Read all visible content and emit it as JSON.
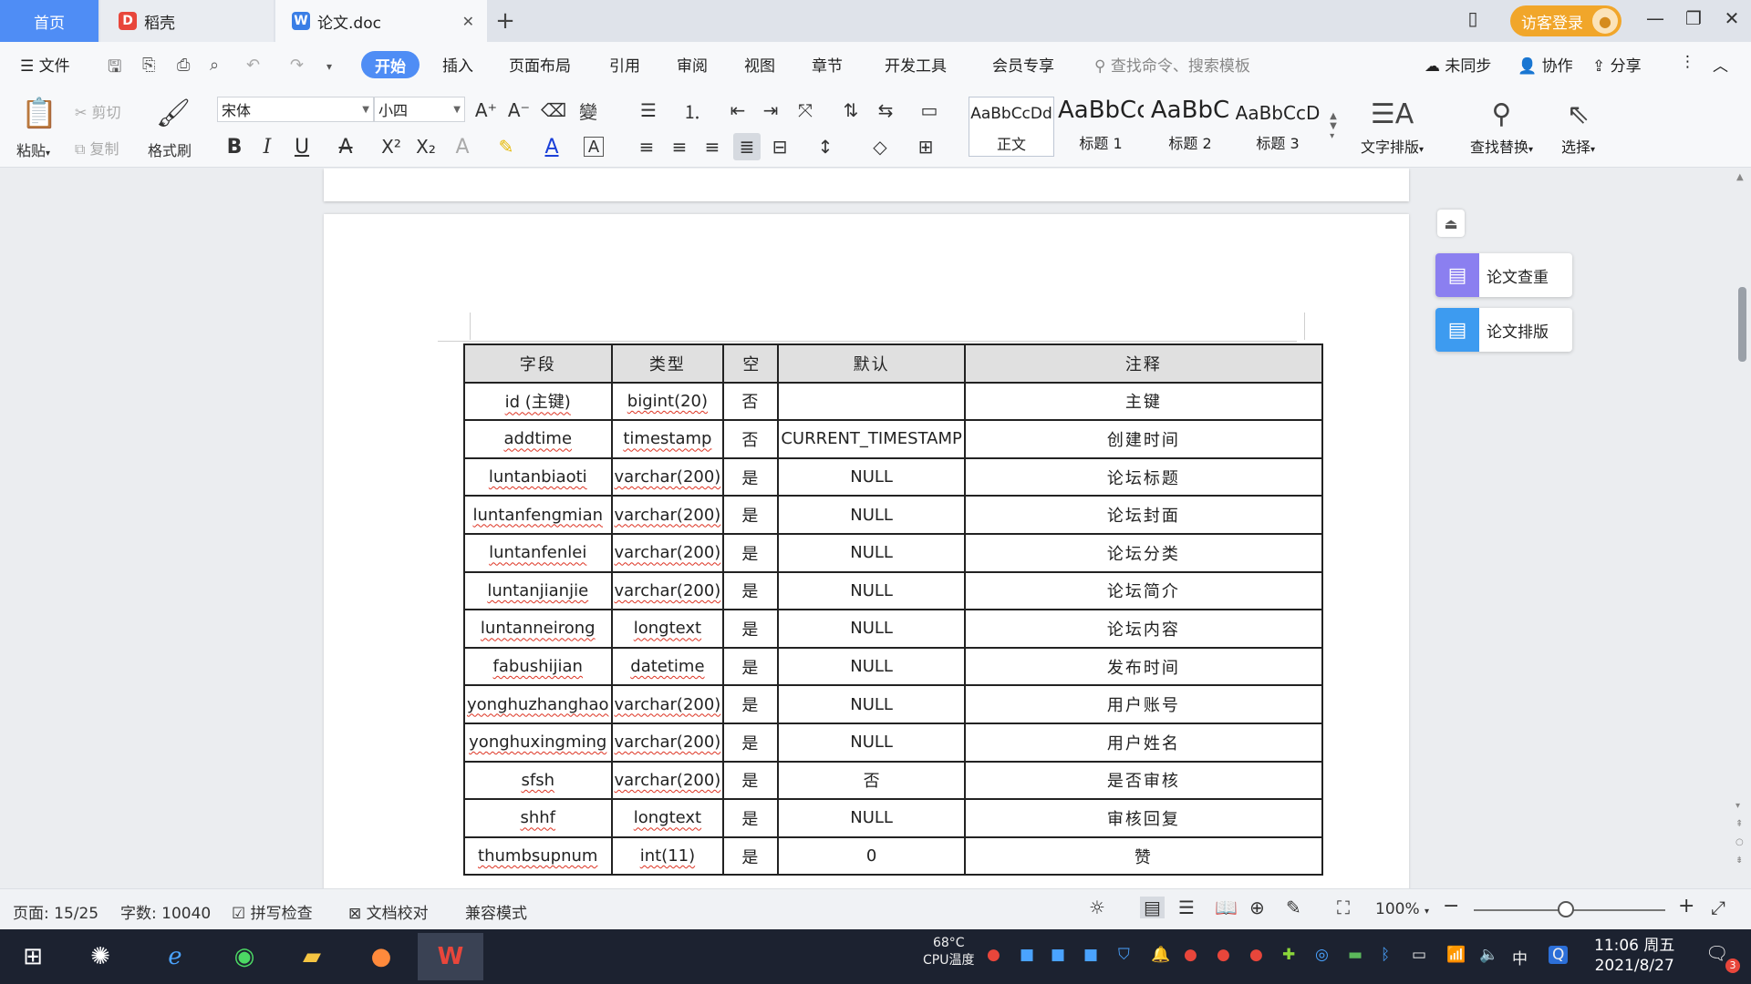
{
  "tabs": {
    "home": "首页",
    "daoke": "稻壳",
    "doc": "论文.doc"
  },
  "titlebar": {
    "login": "访客登录"
  },
  "menu": {
    "file": "文件",
    "items": [
      "开始",
      "插入",
      "页面布局",
      "引用",
      "审阅",
      "视图",
      "章节",
      "开发工具",
      "会员专享"
    ],
    "search_placeholder": "查找命令、搜索模板",
    "sync": "未同步",
    "collab": "协作",
    "share": "分享"
  },
  "ribbon": {
    "paste": "粘贴",
    "cut": "剪切",
    "copy": "复制",
    "format_painter": "格式刷",
    "font_name": "宋体",
    "font_size": "小四",
    "styles": [
      {
        "sample": "AaBbCcDd",
        "name": "正文"
      },
      {
        "sample": "AaBbCc",
        "name": "标题 1"
      },
      {
        "sample": "AaBbC",
        "name": "标题 2"
      },
      {
        "sample": "AaBbCcD",
        "name": "标题 3"
      }
    ],
    "text_layout": "文字排版",
    "find_replace": "查找替换",
    "select": "选择"
  },
  "table": {
    "headers": [
      "字段",
      "类型",
      "空",
      "默认",
      "注释"
    ],
    "rows": [
      [
        "id (主键)",
        "bigint(20)",
        "否",
        "",
        "主键"
      ],
      [
        "addtime",
        "timestamp",
        "否",
        "CURRENT_TIMESTAMP",
        "创建时间"
      ],
      [
        "luntanbiaoti",
        "varchar(200)",
        "是",
        "NULL",
        "论坛标题"
      ],
      [
        "luntanfengmian",
        "varchar(200)",
        "是",
        "NULL",
        "论坛封面"
      ],
      [
        "luntanfenlei",
        "varchar(200)",
        "是",
        "NULL",
        "论坛分类"
      ],
      [
        "luntanjianjie",
        "varchar(200)",
        "是",
        "NULL",
        "论坛简介"
      ],
      [
        "luntanneirong",
        "longtext",
        "是",
        "NULL",
        "论坛内容"
      ],
      [
        "fabushijian",
        "datetime",
        "是",
        "NULL",
        "发布时间"
      ],
      [
        "yonghuzhanghao",
        "varchar(200)",
        "是",
        "NULL",
        "用户账号"
      ],
      [
        "yonghuxingming",
        "varchar(200)",
        "是",
        "NULL",
        "用户姓名"
      ],
      [
        "sfsh",
        "varchar(200)",
        "是",
        "否",
        "是否审核"
      ],
      [
        "shhf",
        "longtext",
        "是",
        "NULL",
        "审核回复"
      ],
      [
        "thumbsupnum",
        "int(11)",
        "是",
        "0",
        "赞"
      ]
    ]
  },
  "side_panel": {
    "check": "论文查重",
    "layout": "论文排版"
  },
  "status": {
    "page": "页面: 15/25",
    "words": "字数: 10040",
    "spell": "拼写检查",
    "proof": "文档校对",
    "compat": "兼容模式",
    "zoom": "100%"
  },
  "taskbar": {
    "temp": "68°C",
    "cpu": "CPU温度",
    "ime": "中",
    "time": "11:06 周五",
    "date": "2021/8/27",
    "notif_count": "3"
  },
  "colors": {
    "accent": "#4f8df5",
    "login": "#f1a62a",
    "side_check": "#8b7ff0",
    "side_layout": "#3d9bf0"
  }
}
